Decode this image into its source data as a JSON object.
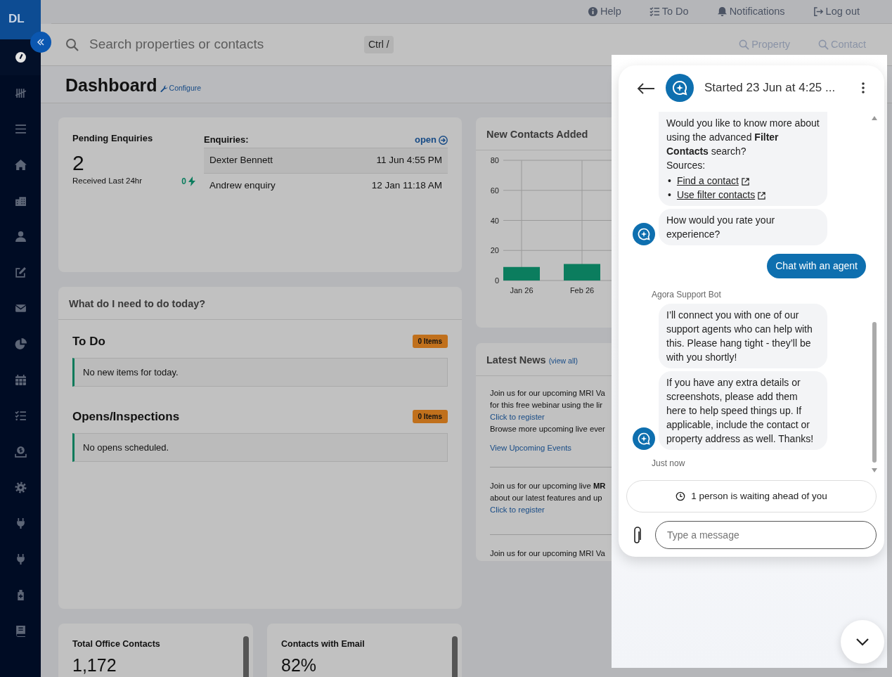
{
  "sidebar": {
    "logo": "DL",
    "items": [
      {
        "selected": true
      },
      {
        "selected": false
      },
      {
        "selected": false
      },
      {
        "selected": false
      },
      {
        "selected": false
      },
      {
        "selected": false
      },
      {
        "selected": false
      },
      {
        "selected": false
      },
      {
        "selected": false
      },
      {
        "selected": false
      },
      {
        "selected": false
      },
      {
        "selected": false
      },
      {
        "selected": false
      },
      {
        "selected": false
      },
      {
        "selected": false
      },
      {
        "selected": false
      },
      {
        "selected": false
      }
    ]
  },
  "top_links": [
    {
      "label": "Help"
    },
    {
      "label": "To Do"
    },
    {
      "label": "Notifications"
    },
    {
      "label": "Log out"
    }
  ],
  "search": {
    "placeholder": "Search properties or contacts",
    "shortcut": "Ctrl /",
    "scopes": [
      "Property",
      "Contact"
    ]
  },
  "page": {
    "title": "Dashboard",
    "configure": "Configure"
  },
  "pending": {
    "title": "Pending Enquiries",
    "count": "2",
    "caption": "Received Last 24hr",
    "last_24hr": "0",
    "list_title": "Enquiries:",
    "open_link": "open",
    "rows": [
      {
        "name": "Dexter Bennett",
        "time": "11 Jun 4:55 PM"
      },
      {
        "name": "Andrew enquiry",
        "time": "12 Jan 11:18 AM"
      }
    ]
  },
  "today": {
    "title": "What do I need to do today?",
    "sections": [
      {
        "title": "To Do",
        "badge": "0 Items",
        "message": "No new items for today."
      },
      {
        "title": "Opens/Inspections",
        "badge": "0 Items",
        "message": "No opens scheduled."
      }
    ]
  },
  "stats": [
    {
      "title": "Total Office Contacts",
      "value": "1,172"
    },
    {
      "title": "Contacts with Email",
      "value": "82%"
    }
  ],
  "new_contacts": {
    "title": "New Contacts Added",
    "chart_data": {
      "type": "bar",
      "categories": [
        "Jan 26",
        "Feb 26"
      ],
      "values": [
        9,
        11
      ],
      "grid": true,
      "ylim": [
        0,
        80
      ],
      "yticks": [
        0,
        20,
        40,
        60,
        80
      ]
    }
  },
  "news": {
    "title": "Latest News",
    "view_all": "(view all)",
    "items": [
      {
        "lines": [
          {
            "kind": "text",
            "text": "Join us for our upcoming MRI Va"
          },
          {
            "kind": "text",
            "text": "for this free webinar using the lir"
          },
          {
            "kind": "link",
            "text": "Click to register"
          },
          {
            "kind": "text",
            "text": "Browse more upcoming live ever"
          },
          {
            "kind": "spaced_link",
            "text": "View Upcoming Events"
          }
        ]
      },
      {
        "lines": [
          {
            "kind": "text",
            "text": "Join us for our upcoming live **MR**"
          },
          {
            "kind": "text",
            "text": "about our latest features and up"
          },
          {
            "kind": "link",
            "text": "Click to register"
          }
        ]
      },
      {
        "lines": [
          {
            "kind": "text",
            "text": "Join us for our upcoming MRI Va"
          }
        ]
      }
    ]
  },
  "chat": {
    "title": "Started 23 Jun at 4:25 ...",
    "messages": [
      {
        "kind": "bot",
        "avatar": false,
        "text": "Would you like to know more about using the advanced **Filter Contacts** search?",
        "sources_label": "Sources:",
        "sources": [
          {
            "marker": "•",
            "text": "Find a contact"
          },
          {
            "marker": "•",
            "text": "Use filter contacts"
          }
        ]
      },
      {
        "kind": "bot",
        "avatar": true,
        "text": "How would you rate your experience?"
      },
      {
        "kind": "user",
        "text": "Chat with an agent"
      },
      {
        "kind": "sender",
        "text": "Agora Support Bot"
      },
      {
        "kind": "bot",
        "avatar": false,
        "text": "I’ll connect you with one of our support agents who can help with this. Please hang tight - they’ll be with you shortly!"
      },
      {
        "kind": "bot",
        "avatar": true,
        "text": "If you have any extra details or screenshots, please add them here to help speed things up. If applicable, include the contact or property address as well. Thanks!"
      },
      {
        "kind": "time",
        "text": "Just now"
      }
    ],
    "queue": "1 person is waiting ahead of you",
    "composer": {
      "placeholder": "Type a message"
    }
  }
}
